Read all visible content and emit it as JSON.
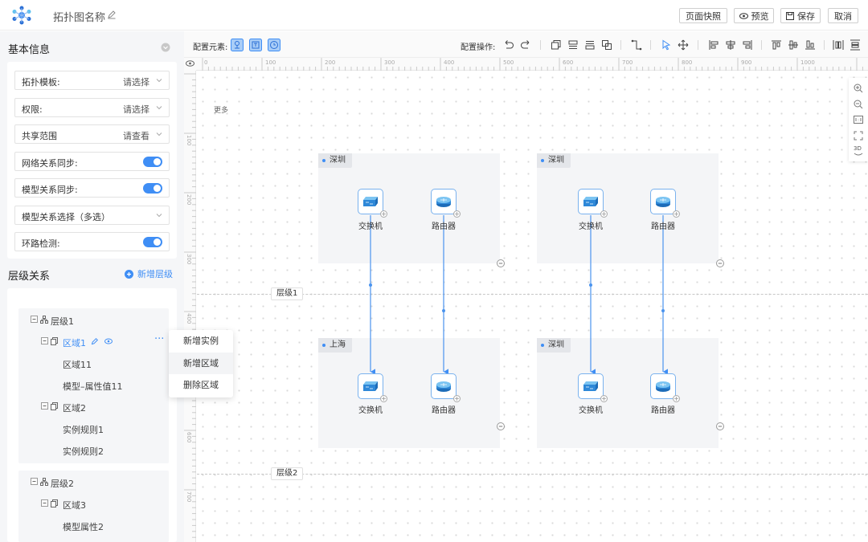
{
  "header": {
    "title": "拓扑图名称",
    "snapshot_label": "页面快照",
    "preview_label": "预览",
    "save_label": "保存",
    "cancel_label": "取消"
  },
  "left": {
    "basic_title": "基本信息",
    "fields": [
      {
        "label": "拓扑模板:",
        "value": "请选择",
        "kind": "select"
      },
      {
        "label": "权限:",
        "value": "请选择",
        "kind": "select"
      },
      {
        "label": "共享范围",
        "value": "请查看",
        "kind": "select"
      },
      {
        "label": "网络关系同步:",
        "kind": "toggle",
        "on": true
      },
      {
        "label": "模型关系同步:",
        "kind": "toggle",
        "on": true
      },
      {
        "label": "模型关系选择（多选）",
        "kind": "select"
      },
      {
        "label": "环路检测:",
        "kind": "toggle",
        "on": true
      }
    ],
    "hier_title": "层级关系",
    "add_layer": "新增层级",
    "tree": {
      "layer1": "层级1",
      "region1": "区域1",
      "region1_children": [
        "区域11",
        "模型–属性值11"
      ],
      "region2": "区域2",
      "region2_children": [
        "实例规则1",
        "实例规则2"
      ],
      "layer2": "层级2",
      "region3": "区域3",
      "region3_children": [
        "模型属性2"
      ]
    }
  },
  "context_menu": [
    "新增实例",
    "新增区域",
    "删除区域"
  ],
  "toolbar": {
    "config_elements": "配置元素:",
    "config_ops": "配置操作:"
  },
  "ruler": {
    "top_ticks": [
      "0",
      "100",
      "200",
      "300",
      "400",
      "500",
      "600",
      "700",
      "800",
      "900",
      "1000"
    ],
    "left_ticks": [
      "100",
      "200",
      "300",
      "400",
      "500",
      "600",
      "700",
      "800",
      "900"
    ]
  },
  "canvas": {
    "more": "更多",
    "layers": [
      "层级1",
      "层级2"
    ],
    "regions": [
      {
        "name": "深圳",
        "devices": [
          "交换机",
          "路由器"
        ]
      },
      {
        "name": "深圳",
        "devices": [
          "交换机",
          "路由器"
        ]
      },
      {
        "name": "上海",
        "devices": [
          "交换机",
          "路由器"
        ]
      },
      {
        "name": "深圳",
        "devices": [
          "交换机",
          "路由器"
        ]
      }
    ]
  },
  "zoom_panel": {
    "threed": "3D"
  },
  "colors": {
    "accent": "#3f8ef5",
    "panel_bg": "#f5f6f8",
    "region_bg": "#f4f5f7"
  }
}
